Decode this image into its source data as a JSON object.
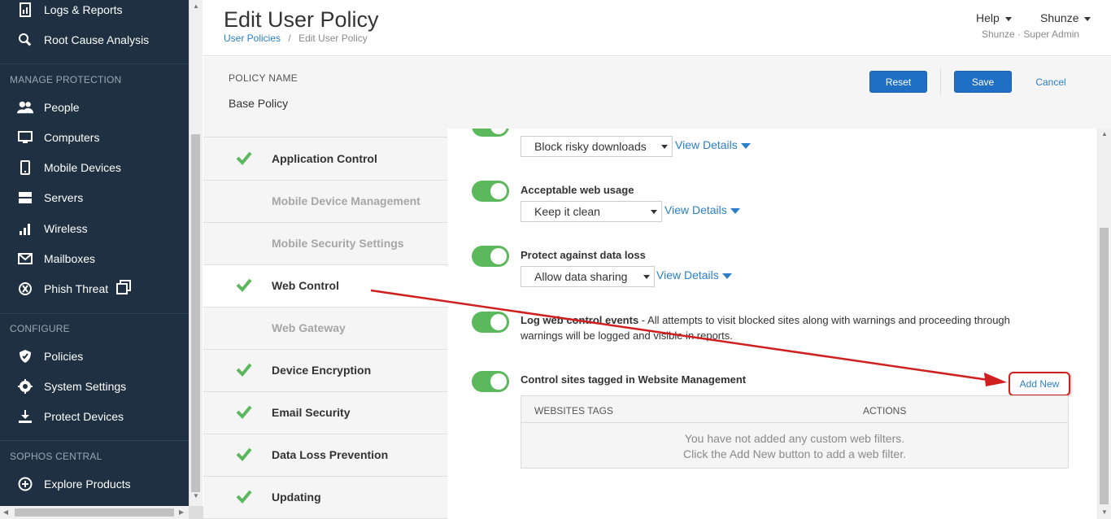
{
  "sidebar": {
    "items_top": [
      {
        "label": "Logs & Reports",
        "icon": "report-icon"
      },
      {
        "label": "Root Cause Analysis",
        "icon": "magnifier-icon"
      }
    ],
    "sections": [
      {
        "title": "MANAGE PROTECTION",
        "items": [
          {
            "label": "People",
            "icon": "people-icon"
          },
          {
            "label": "Computers",
            "icon": "monitor-icon"
          },
          {
            "label": "Mobile Devices",
            "icon": "mobile-icon"
          },
          {
            "label": "Servers",
            "icon": "server-icon"
          },
          {
            "label": "Wireless",
            "icon": "signal-icon"
          },
          {
            "label": "Mailboxes",
            "icon": "envelope-icon"
          },
          {
            "label": "Phish Threat",
            "icon": "hook-icon"
          }
        ]
      },
      {
        "title": "CONFIGURE",
        "items": [
          {
            "label": "Policies",
            "icon": "shield-icon"
          },
          {
            "label": "System Settings",
            "icon": "gear-icon"
          },
          {
            "label": "Protect Devices",
            "icon": "download-icon"
          }
        ]
      },
      {
        "title": "SOPHOS CENTRAL",
        "items": [
          {
            "label": "Explore Products",
            "icon": "plus-circle-icon"
          }
        ]
      }
    ]
  },
  "header": {
    "title": "Edit User Policy",
    "breadcrumb": {
      "parent": "User Policies",
      "separator": "/",
      "current": "Edit User Policy"
    },
    "help": "Help",
    "user": "Shunze",
    "role": "Shunze · Super Admin"
  },
  "policy": {
    "name_label": "POLICY NAME",
    "name_value": "Base Policy",
    "reset": "Reset",
    "save": "Save",
    "cancel": "Cancel"
  },
  "tabs": [
    {
      "label": "Application Control",
      "checked": true,
      "enabled": true
    },
    {
      "label": "Mobile Device Management",
      "checked": false,
      "enabled": false
    },
    {
      "label": "Mobile Security Settings",
      "checked": false,
      "enabled": false
    },
    {
      "label": "Web Control",
      "checked": true,
      "enabled": true,
      "active": true
    },
    {
      "label": "Web Gateway",
      "checked": false,
      "enabled": false
    },
    {
      "label": "Device Encryption",
      "checked": true,
      "enabled": true
    },
    {
      "label": "Email Security",
      "checked": true,
      "enabled": true
    },
    {
      "label": "Data Loss Prevention",
      "checked": true,
      "enabled": true
    },
    {
      "label": "Updating",
      "checked": true,
      "enabled": true
    }
  ],
  "web_control": {
    "risky": {
      "select": "Block risky downloads",
      "details": "View Details"
    },
    "acceptable": {
      "title": "Acceptable web usage",
      "select": "Keep it clean",
      "details": "View Details"
    },
    "data_loss": {
      "title": "Protect against data loss",
      "select": "Allow data sharing",
      "details": "View Details"
    },
    "log": {
      "title": "Log web control events",
      "text_line1": " - All attempts to visit blocked sites along with warnings and proceeding through",
      "text_line2": "warnings will be logged and visible in reports."
    },
    "tagged": {
      "title": "Control sites tagged in Website Management",
      "add_new": "Add New",
      "col_tags": "WEBSITES TAGS",
      "col_actions": "ACTIONS",
      "empty_line1": "You have not added any custom web filters.",
      "empty_line2": "Click the Add New button to add a web filter."
    }
  },
  "colors": {
    "sidebar_bg": "#1e3042",
    "primary": "#1f6fc5",
    "link": "#2b7fc9",
    "toggle_on": "#5cb85c",
    "annotation": "#d01f1f"
  }
}
